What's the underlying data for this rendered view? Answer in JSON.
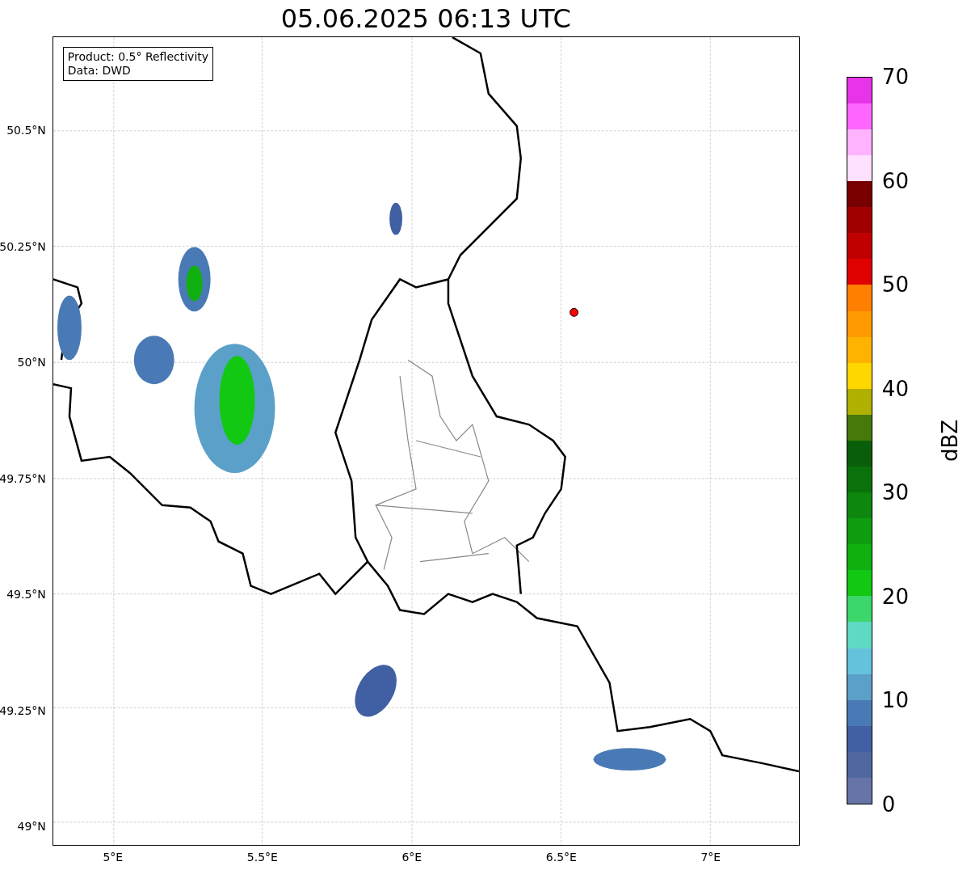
{
  "title": "05.06.2025 06:13 UTC",
  "info_box": {
    "lines": [
      "Product: 0.5° Reflectivity",
      "Data: DWD"
    ]
  },
  "y_axis": {
    "ticks": [
      "50.5°N",
      "50.25°N",
      "50°N",
      "49.75°N",
      "49.5°N",
      "49.25°N",
      "49°N"
    ]
  },
  "x_axis": {
    "ticks": [
      "5°E",
      "5.5°E",
      "6°E",
      "6.5°E",
      "7°E"
    ]
  },
  "colorbar": {
    "label": "dBZ",
    "ticks": [
      "70",
      "60",
      "50",
      "40",
      "30",
      "20",
      "10",
      "0"
    ],
    "bands": [
      {
        "color": "#6674a8"
      },
      {
        "color": "#5068a0"
      },
      {
        "color": "#4060a3"
      },
      {
        "color": "#4a7ab5"
      },
      {
        "color": "#5ba0c8"
      },
      {
        "color": "#65c2dc"
      },
      {
        "color": "#60d9c4"
      },
      {
        "color": "#3cd66a"
      },
      {
        "color": "#12c812"
      },
      {
        "color": "#11b011"
      },
      {
        "color": "#0f9c0f"
      },
      {
        "color": "#0d870d"
      },
      {
        "color": "#0b720b"
      },
      {
        "color": "#0a5e0a"
      },
      {
        "color": "#457a0a"
      },
      {
        "color": "#b0b000"
      },
      {
        "color": "#ffd700"
      },
      {
        "color": "#ffb300"
      },
      {
        "color": "#ff9900"
      },
      {
        "color": "#ff7f00"
      },
      {
        "color": "#e00000"
      },
      {
        "color": "#c00000"
      },
      {
        "color": "#a00000"
      },
      {
        "color": "#780000"
      },
      {
        "color": "#ffe0ff"
      },
      {
        "color": "#ffb3ff"
      },
      {
        "color": "#ff66ff"
      },
      {
        "color": "#e834e8"
      }
    ]
  }
}
